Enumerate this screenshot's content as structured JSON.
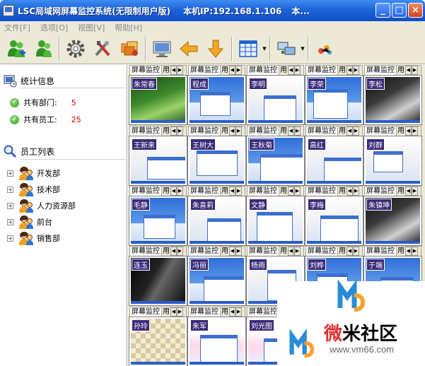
{
  "window": {
    "title": "LSC局域网屏幕监控系统(无限制用户版)",
    "ip_label": "本机IP:192.168.1.106",
    "extra": "本...",
    "minimize": "_",
    "maximize": "□",
    "close": "×"
  },
  "menu": [
    {
      "label": "文件[F]"
    },
    {
      "label": "选项[O]"
    },
    {
      "label": "视图[V]"
    },
    {
      "label": "帮助[H]"
    }
  ],
  "toolbar": {
    "buttons": [
      "users-add-icon",
      "users-icon",
      "gear-icon",
      "tools-icon",
      "monitor-group-icon",
      "monitor-icon",
      "arrow-left-icon",
      "arrow-down-icon",
      "grid-view-icon",
      "screens-icon",
      "network-icon"
    ]
  },
  "sidebar": {
    "stats_title": "统计信息",
    "stats": [
      {
        "label": "共有部门:",
        "value": "5"
      },
      {
        "label": "共有员工:",
        "value": "25"
      }
    ],
    "employee_title": "员工列表",
    "departments": [
      {
        "label": "开发部"
      },
      {
        "label": "技术部"
      },
      {
        "label": "人力资源部"
      },
      {
        "label": "前台"
      },
      {
        "label": "销售部"
      }
    ]
  },
  "grid": {
    "tab_label": "屏幕监控",
    "tab2_label": "用",
    "arrow_left": "◀",
    "arrow_right": "▶",
    "cells": [
      {
        "name": "朱常春",
        "theme": "green"
      },
      {
        "name": "程成",
        "theme": "xp"
      },
      {
        "name": "李明",
        "theme": "doc"
      },
      {
        "name": "李荣",
        "theme": "xp"
      },
      {
        "name": "李松",
        "theme": "dark"
      },
      {
        "name": "王新来",
        "theme": "doc"
      },
      {
        "name": "王树大",
        "theme": "doc"
      },
      {
        "name": "王秋菊",
        "theme": "xp"
      },
      {
        "name": "高红",
        "theme": "doc"
      },
      {
        "name": "刘群",
        "theme": "doc"
      },
      {
        "name": "毛静",
        "theme": "xp"
      },
      {
        "name": "朱喜莉",
        "theme": "doc"
      },
      {
        "name": "文静",
        "theme": "doc"
      },
      {
        "name": "李梅",
        "theme": "doc"
      },
      {
        "name": "朱镇坤",
        "theme": "dark"
      },
      {
        "name": "连玉",
        "theme": "gun"
      },
      {
        "name": "冯丽",
        "theme": "xp"
      },
      {
        "name": "杨雨",
        "theme": "doc"
      },
      {
        "name": "刘桦",
        "theme": "xp"
      },
      {
        "name": "于端",
        "theme": "xp"
      },
      {
        "name": "孙玲",
        "theme": "chess"
      },
      {
        "name": "朱军",
        "theme": "web"
      },
      {
        "name": "刘光图",
        "theme": "web"
      }
    ]
  },
  "watermark": {
    "brand_red": "微",
    "brand_black": "米社区",
    "url": "www.vm66.com"
  },
  "colors": {
    "titlebar": "#1e63d8",
    "chrome": "#ece9d8",
    "stat_value": "#c00000",
    "name_badge": "#3a2a78"
  }
}
